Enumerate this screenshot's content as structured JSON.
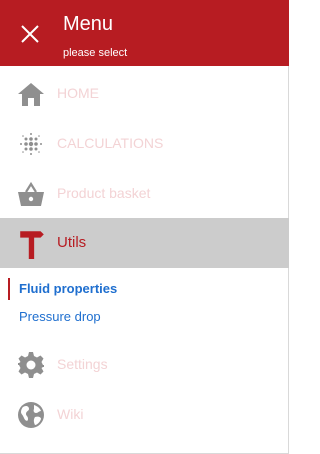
{
  "colors": {
    "accent": "#b71c22",
    "active_bg": "#cccccc",
    "link": "#1f6fcf",
    "muted_label": "#f3d3d5",
    "icon": "#8f8f8f"
  },
  "header": {
    "title": "Menu",
    "subtitle": "please select",
    "close_icon": "close-icon"
  },
  "menu": {
    "items": [
      {
        "label": "HOME",
        "icon": "home-icon"
      },
      {
        "label": "CALCULATIONS",
        "icon": "calculations-icon"
      },
      {
        "label": "Product basket",
        "icon": "basket-icon"
      },
      {
        "label": "Utils",
        "icon": "hammer-icon",
        "active": true
      },
      {
        "label": "Settings",
        "icon": "gear-icon"
      },
      {
        "label": "Wiki",
        "icon": "globe-icon"
      }
    ],
    "sub_items": [
      {
        "label": "Fluid properties",
        "current": true
      },
      {
        "label": "Pressure drop"
      }
    ]
  }
}
